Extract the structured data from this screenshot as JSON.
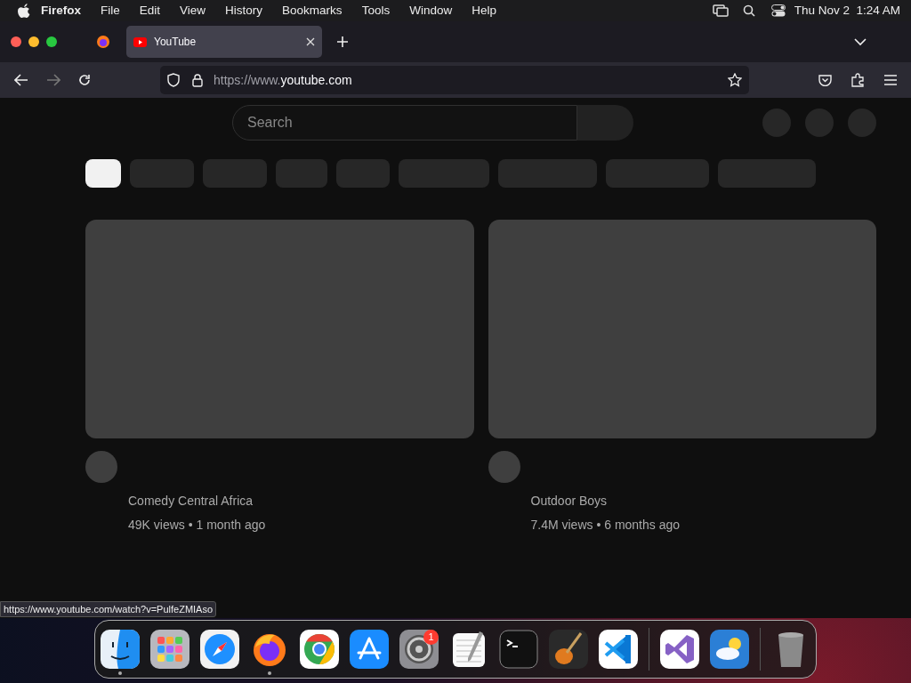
{
  "menu_bar": {
    "app": "Firefox",
    "items": [
      "File",
      "Edit",
      "View",
      "History",
      "Bookmarks",
      "Tools",
      "Window",
      "Help"
    ],
    "clock": "Thu Nov 2  1:24 AM"
  },
  "tabs": [
    {
      "title": "YouTube",
      "selected": true
    }
  ],
  "address_bar": {
    "prefix": "https://www.",
    "domain": "youtube.com"
  },
  "search": {
    "placeholder": "Search"
  },
  "videos": [
    {
      "channel": "Comedy Central Africa",
      "meta": "49K views • 1 month ago"
    },
    {
      "channel": "Outdoor Boys",
      "meta": "7.4M views • 6 months ago"
    }
  ],
  "status_link": "https://www.youtube.com/watch?v=PulfeZMIAso",
  "dock": [
    {
      "kind": "finder",
      "running": true
    },
    {
      "kind": "launchpad",
      "running": false
    },
    {
      "kind": "safari",
      "running": false
    },
    {
      "kind": "firefox",
      "running": true
    },
    {
      "kind": "chrome",
      "running": false
    },
    {
      "kind": "appstore",
      "running": false
    },
    {
      "kind": "settings",
      "running": false,
      "badge": "1"
    },
    {
      "kind": "textedit",
      "running": false
    },
    {
      "kind": "terminal",
      "running": false
    },
    {
      "kind": "garageband",
      "running": false
    },
    {
      "kind": "vscode",
      "running": false
    },
    {
      "kind": "divider"
    },
    {
      "kind": "visualstudio",
      "running": false
    },
    {
      "kind": "weather",
      "running": false
    },
    {
      "kind": "divider"
    },
    {
      "kind": "trash",
      "running": false
    }
  ]
}
